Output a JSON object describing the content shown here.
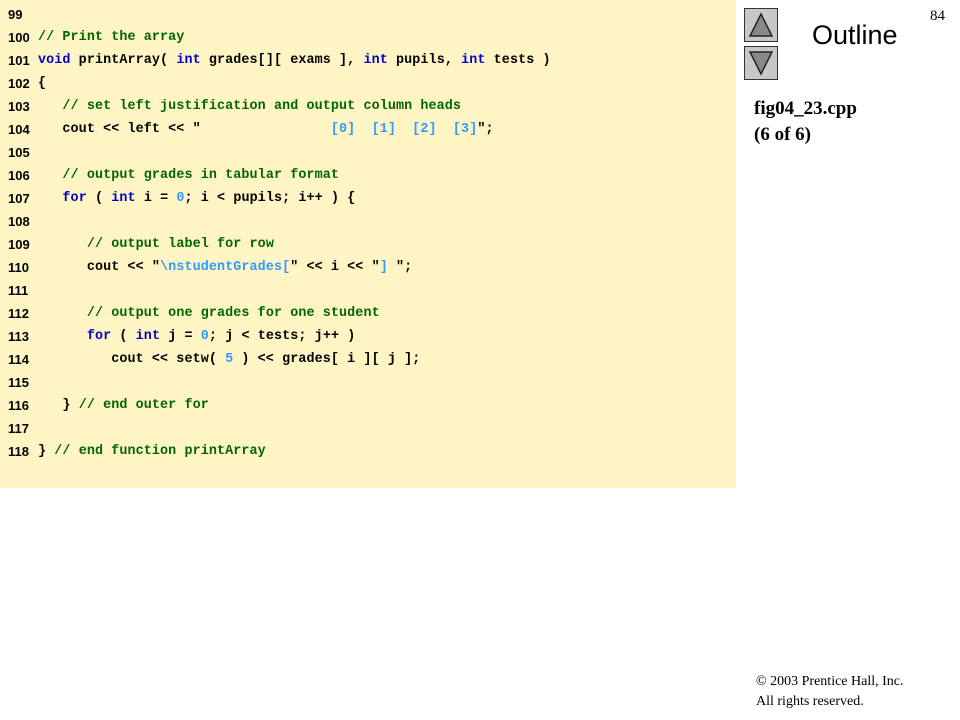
{
  "slide": {
    "page_number": "84",
    "outline_label": "Outline",
    "file_name": "fig04_23.cpp",
    "file_part": "(6 of 6)",
    "copyright_line1": "© 2003 Prentice Hall, Inc.",
    "copyright_line2": "All rights reserved."
  },
  "colors": {
    "code_background": "#fff5c4",
    "keyword": "#0000cc",
    "comment": "#006600",
    "literal": "#3399ff"
  },
  "icons": {
    "nav_up": "triangle-up-icon",
    "nav_down": "triangle-down-icon"
  },
  "code_lines": [
    {
      "n": "99",
      "segs": []
    },
    {
      "n": "100",
      "segs": [
        {
          "t": "cm",
          "v": "// Print the array"
        }
      ]
    },
    {
      "n": "101",
      "segs": [
        {
          "t": "kw",
          "v": "void"
        },
        {
          "t": "tx",
          "v": " printArray( "
        },
        {
          "t": "kw",
          "v": "int"
        },
        {
          "t": "tx",
          "v": " grades[][ exams ], "
        },
        {
          "t": "kw",
          "v": "int"
        },
        {
          "t": "tx",
          "v": " pupils, "
        },
        {
          "t": "kw",
          "v": "int"
        },
        {
          "t": "tx",
          "v": " tests )"
        }
      ]
    },
    {
      "n": "102",
      "segs": [
        {
          "t": "tx",
          "v": "{"
        }
      ]
    },
    {
      "n": "103",
      "segs": [
        {
          "t": "tx",
          "v": "   "
        },
        {
          "t": "cm",
          "v": "// set left justification and output column heads"
        }
      ]
    },
    {
      "n": "104",
      "segs": [
        {
          "t": "tx",
          "v": "   cout << left << \""
        },
        {
          "t": "lit",
          "v": "                [0]  [1]  [2]  [3]"
        },
        {
          "t": "tx",
          "v": "\";"
        }
      ]
    },
    {
      "n": "105",
      "segs": []
    },
    {
      "n": "106",
      "segs": [
        {
          "t": "tx",
          "v": "   "
        },
        {
          "t": "cm",
          "v": "// output grades in tabular format"
        }
      ]
    },
    {
      "n": "107",
      "segs": [
        {
          "t": "tx",
          "v": "   "
        },
        {
          "t": "kw",
          "v": "for"
        },
        {
          "t": "tx",
          "v": " ( "
        },
        {
          "t": "kw",
          "v": "int"
        },
        {
          "t": "tx",
          "v": " i = "
        },
        {
          "t": "num",
          "v": "0"
        },
        {
          "t": "tx",
          "v": "; i < pupils; i++ ) {"
        }
      ]
    },
    {
      "n": "108",
      "segs": []
    },
    {
      "n": "109",
      "segs": [
        {
          "t": "tx",
          "v": "      "
        },
        {
          "t": "cm",
          "v": "// output label for row"
        }
      ]
    },
    {
      "n": "110",
      "segs": [
        {
          "t": "tx",
          "v": "      cout << \""
        },
        {
          "t": "lit",
          "v": "\\nstudentGrades["
        },
        {
          "t": "tx",
          "v": "\" << i << \""
        },
        {
          "t": "lit",
          "v": "] "
        },
        {
          "t": "tx",
          "v": "\";"
        }
      ]
    },
    {
      "n": "111",
      "segs": []
    },
    {
      "n": "112",
      "segs": [
        {
          "t": "tx",
          "v": "      "
        },
        {
          "t": "cm",
          "v": "// output one grades for one student"
        }
      ]
    },
    {
      "n": "113",
      "segs": [
        {
          "t": "tx",
          "v": "      "
        },
        {
          "t": "kw",
          "v": "for"
        },
        {
          "t": "tx",
          "v": " ( "
        },
        {
          "t": "kw",
          "v": "int"
        },
        {
          "t": "tx",
          "v": " j = "
        },
        {
          "t": "num",
          "v": "0"
        },
        {
          "t": "tx",
          "v": "; j < tests; j++ )"
        }
      ]
    },
    {
      "n": "114",
      "segs": [
        {
          "t": "tx",
          "v": "         cout << setw( "
        },
        {
          "t": "num",
          "v": "5"
        },
        {
          "t": "tx",
          "v": " ) << grades[ i ][ j ];"
        }
      ]
    },
    {
      "n": "115",
      "segs": []
    },
    {
      "n": "116",
      "segs": [
        {
          "t": "tx",
          "v": "   } "
        },
        {
          "t": "cm",
          "v": "// end outer for"
        }
      ]
    },
    {
      "n": "117",
      "segs": []
    },
    {
      "n": "118",
      "segs": [
        {
          "t": "tx",
          "v": "} "
        },
        {
          "t": "cm",
          "v": "// end function printArray"
        }
      ]
    }
  ]
}
